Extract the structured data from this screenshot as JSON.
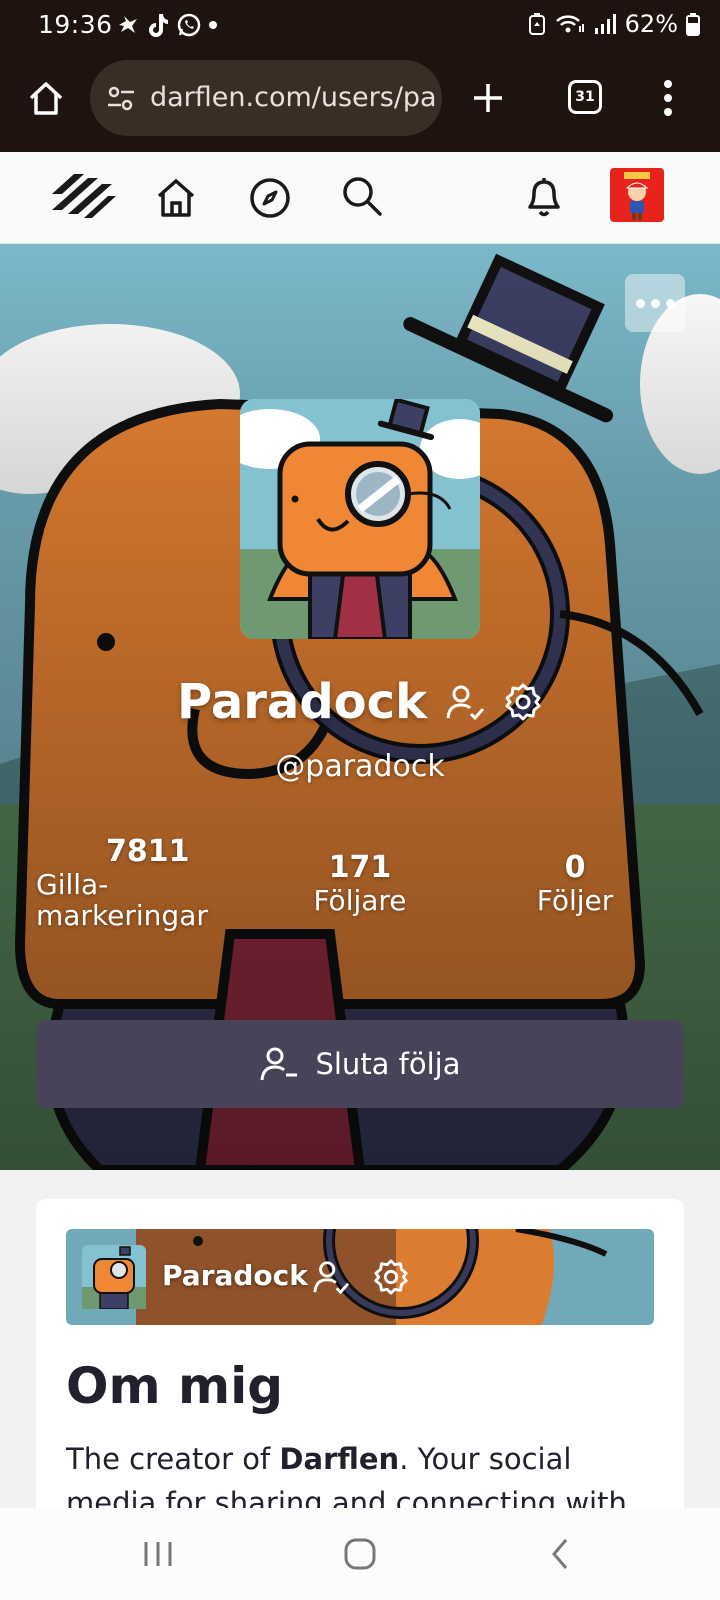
{
  "status_bar": {
    "time": "19:36",
    "battery": "62%"
  },
  "browser": {
    "url": "darflen.com/users/pa",
    "tab_count": "31"
  },
  "profile": {
    "display_name": "Paradock",
    "handle": "@paradock",
    "stats": [
      {
        "value": "7811",
        "label": "Gilla-\nmarkeringar"
      },
      {
        "value": "171",
        "label": "Följare"
      },
      {
        "value": "0",
        "label": "Följer"
      }
    ],
    "unfollow_label": "Sluta följa"
  },
  "about": {
    "mini_name": "Paradock",
    "title": "Om mig",
    "text_before": "The creator of ",
    "text_bold": "Darflen",
    "text_after": ". Your social media for sharing and connecting with your"
  },
  "colors": {
    "browser_chrome": "#1e130e",
    "accent_button": "#474359",
    "sky": "#7bb8c9",
    "character_orange": "#ef8735",
    "header_avatar_bg": "#e8231c"
  },
  "icons": {
    "header": [
      "darflen-logo",
      "home-icon",
      "explore-compass-icon",
      "search-icon",
      "bell-icon",
      "user-avatar"
    ],
    "profile": [
      "following-check-icon",
      "settings-gear-icon",
      "unfollow-icon",
      "more-dots-icon"
    ]
  }
}
